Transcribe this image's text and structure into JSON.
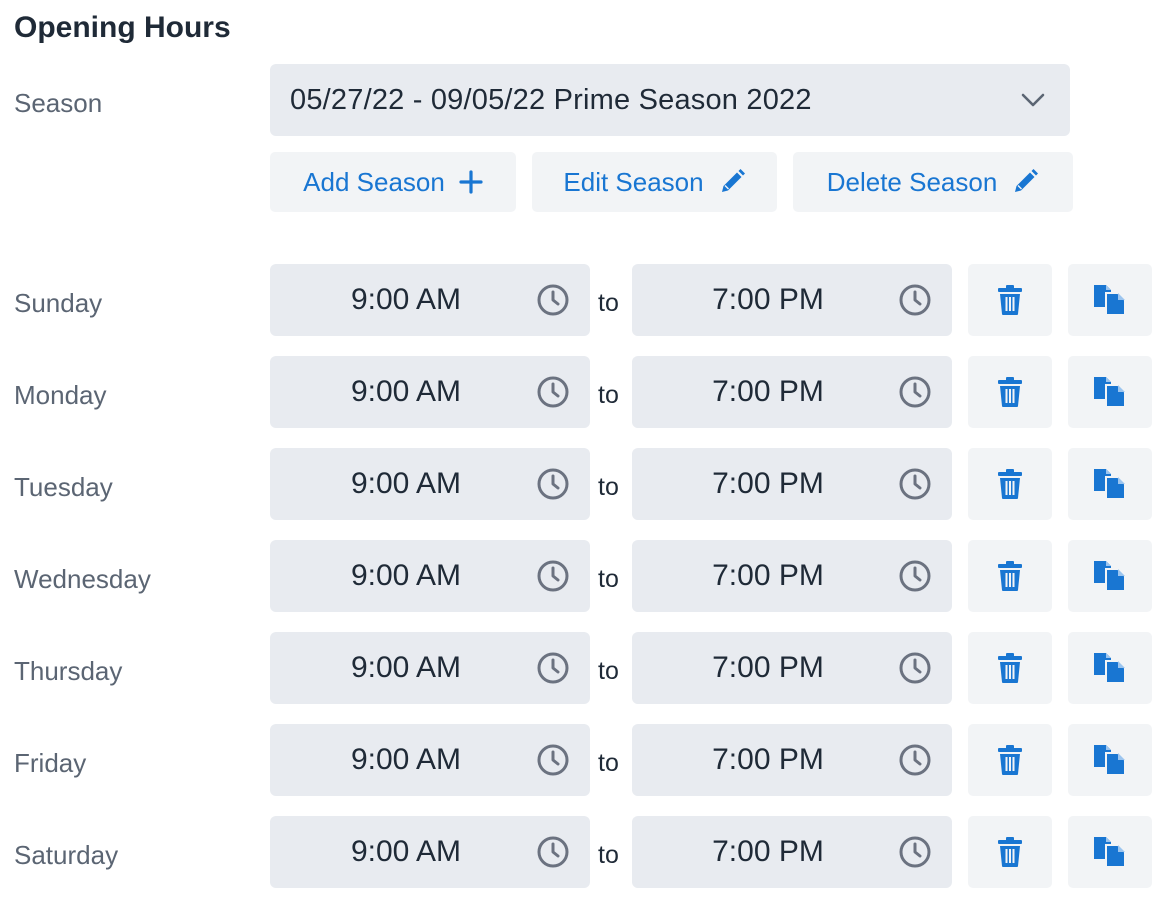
{
  "page": {
    "title": "Opening Hours",
    "season_label": "Season",
    "separator": "to"
  },
  "season": {
    "selected": "05/27/22 - 09/05/22 Prime Season 2022"
  },
  "actions": {
    "add": "Add Season",
    "edit": "Edit Season",
    "delete": "Delete Season"
  },
  "days": [
    {
      "name": "Sunday",
      "open": "9:00 AM",
      "close": "7:00 PM"
    },
    {
      "name": "Monday",
      "open": "9:00 AM",
      "close": "7:00 PM"
    },
    {
      "name": "Tuesday",
      "open": "9:00 AM",
      "close": "7:00 PM"
    },
    {
      "name": "Wednesday",
      "open": "9:00 AM",
      "close": "7:00 PM"
    },
    {
      "name": "Thursday",
      "open": "9:00 AM",
      "close": "7:00 PM"
    },
    {
      "name": "Friday",
      "open": "9:00 AM",
      "close": "7:00 PM"
    },
    {
      "name": "Saturday",
      "open": "9:00 AM",
      "close": "7:00 PM"
    }
  ],
  "icons": {
    "dropdown": "chevron-down-icon",
    "add": "plus-icon",
    "edit": "pencil-icon",
    "clock": "clock-icon",
    "delete": "trash-icon",
    "copy": "copy-icon"
  },
  "colors": {
    "accent": "#1976d2",
    "field_bg": "#e8ebf0",
    "button_bg": "#f2f4f6",
    "label": "#5b6573",
    "text": "#1f2a37"
  }
}
